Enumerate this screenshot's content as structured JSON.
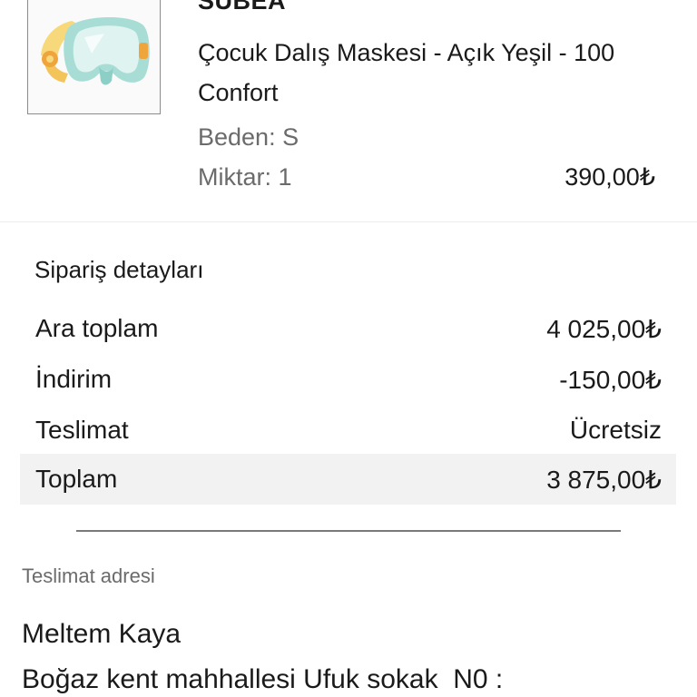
{
  "product": {
    "brand": "SUBEA",
    "name": "Çocuk Dalış Maskesi - Açık Yeşil - 100 Confort",
    "size": "Beden: S",
    "quantity": "Miktar: 1",
    "price": "390,00₺"
  },
  "order_details": {
    "title": "Sipariş detayları",
    "rows": [
      {
        "label": "Ara toplam",
        "value": "4 025,00₺"
      },
      {
        "label": "İndirim",
        "value": "-150,00₺"
      },
      {
        "label": "Teslimat",
        "value": "Ücretsiz"
      },
      {
        "label": "Toplam",
        "value": "3 875,00₺"
      }
    ]
  },
  "shipping_address": {
    "title": "Teslimat adresi",
    "name": "Meltem Kaya",
    "line1": "Boğaz kent mahhallesi Ufuk sokak  N0 :"
  },
  "colors": {
    "text": "#1a1a1a",
    "muted": "#6b6b6b",
    "total_row_bg": "#f2f2f2",
    "mask_frame": "#a8ddd6",
    "mask_strap": "#f7d87a"
  }
}
